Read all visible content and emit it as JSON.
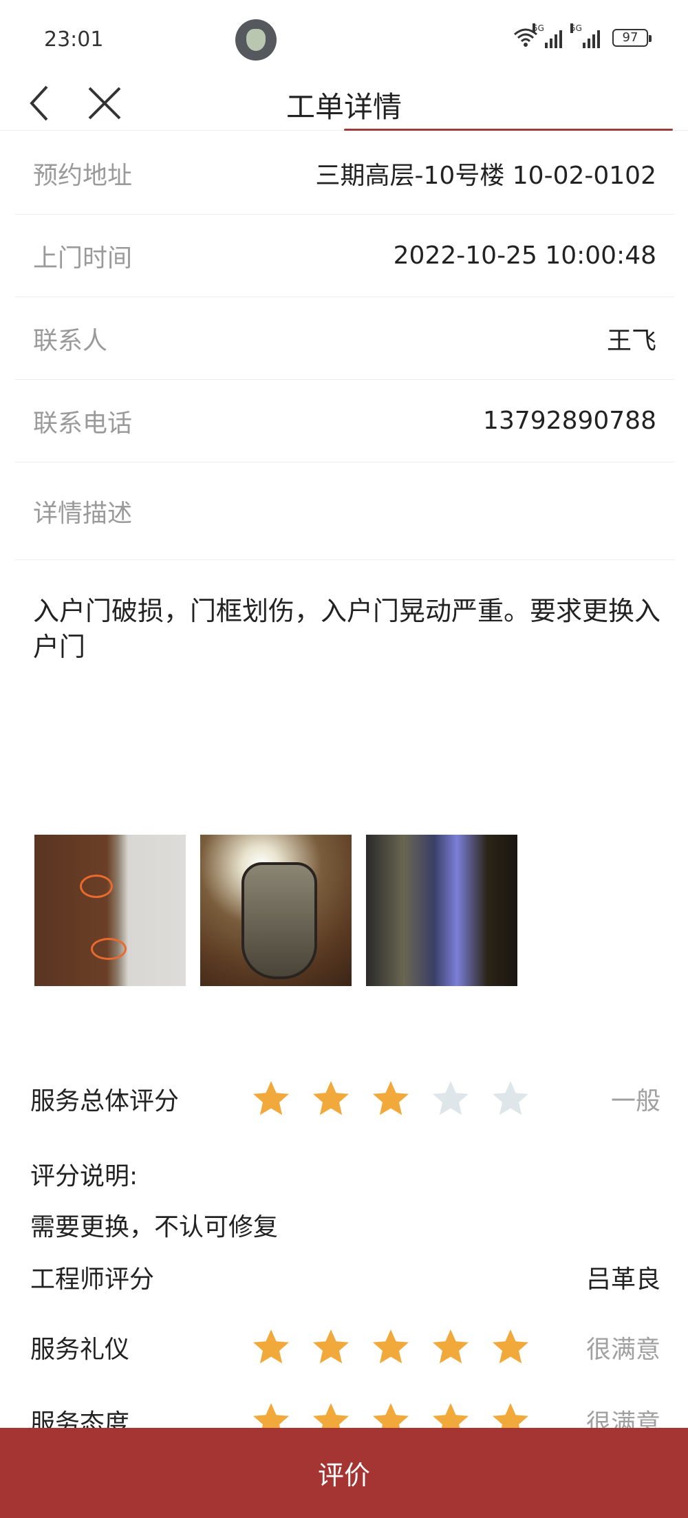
{
  "status_bar": {
    "time": "23:01",
    "network_1": "5G",
    "network_2": "5G",
    "battery": "97"
  },
  "nav": {
    "title": "工单详情"
  },
  "info": [
    {
      "label": "预约地址",
      "value": "三期高层-10号楼 10-02-0102"
    },
    {
      "label": "上门时间",
      "value": "2022-10-25 10:00:48"
    },
    {
      "label": "联系人",
      "value": "王飞"
    },
    {
      "label": "联系电话",
      "value": "13792890788"
    },
    {
      "label": "详情描述",
      "value": ""
    }
  ],
  "description": "入户门破损，门框划伤，入户门晃动严重。要求更换入户门",
  "ratings": {
    "overall": {
      "label": "服务总体评分",
      "stars": 3,
      "max": 5,
      "word": "一般"
    },
    "comment_label": "评分说明:",
    "comment": "需要更换，不认可修复",
    "engineer_label": "工程师评分",
    "engineer_name": "吕革良",
    "etiquette": {
      "label": "服务礼仪",
      "stars": 5,
      "max": 5,
      "word": "很满意"
    },
    "attitude": {
      "label": "服务态度",
      "stars": 5,
      "max": 5,
      "word": "很满意"
    }
  },
  "colors": {
    "accent": "#a53533",
    "star_on": "#f2a93b",
    "star_off": "#dfe6ea"
  },
  "bottom_button": "评价"
}
